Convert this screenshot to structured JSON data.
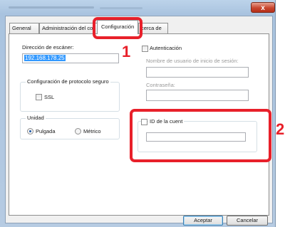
{
  "window": {
    "close_glyph": "x",
    "close_icon": "close-icon"
  },
  "tabs": [
    {
      "label": "General"
    },
    {
      "label": "Administración del co"
    },
    {
      "label": "Configuración"
    },
    {
      "label": "cerca de"
    }
  ],
  "scanner": {
    "address_label": "Dirección de escáner:",
    "address_value": "192.168.178.25"
  },
  "secure_protocol": {
    "legend": "Configuración de protocolo seguro",
    "ssl_label": "SSL",
    "ssl_checked": false
  },
  "unit": {
    "legend": "Unidad",
    "inch_label": "Pulgada",
    "metric_label": "Métrico",
    "selected": "Pulgada"
  },
  "auth": {
    "checkbox_label": "Autenticación",
    "checked": false,
    "username_label": "Nombre de usuario de inicio de sesión:",
    "username_value": "",
    "password_label": "Contraseña:",
    "password_value": ""
  },
  "account": {
    "checkbox_label": "ID de la cuent",
    "checked": false,
    "value": ""
  },
  "buttons": {
    "ok": "Aceptar",
    "cancel": "Cancelar"
  },
  "callouts": {
    "one": "1",
    "two": "2",
    "color": "#e8202a"
  }
}
